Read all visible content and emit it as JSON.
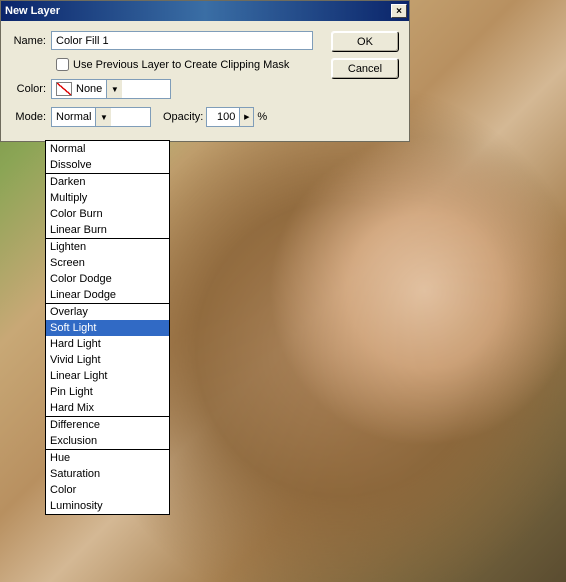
{
  "dialog": {
    "title": "New Layer",
    "name_label": "Name:",
    "name_value": "Color Fill 1",
    "clipping_label": "Use Previous Layer to Create Clipping Mask",
    "color_label": "Color:",
    "color_value": "None",
    "mode_label": "Mode:",
    "mode_value": "Normal",
    "opacity_label": "Opacity:",
    "opacity_value": "100",
    "opacity_unit": "%",
    "ok": "OK",
    "cancel": "Cancel",
    "close_glyph": "×"
  },
  "mode_dropdown": {
    "selected": "Soft Light",
    "groups": [
      [
        "Normal",
        "Dissolve"
      ],
      [
        "Darken",
        "Multiply",
        "Color Burn",
        "Linear Burn"
      ],
      [
        "Lighten",
        "Screen",
        "Color Dodge",
        "Linear Dodge"
      ],
      [
        "Overlay",
        "Soft Light",
        "Hard Light",
        "Vivid Light",
        "Linear Light",
        "Pin Light",
        "Hard Mix"
      ],
      [
        "Difference",
        "Exclusion"
      ],
      [
        "Hue",
        "Saturation",
        "Color",
        "Luminosity"
      ]
    ]
  }
}
